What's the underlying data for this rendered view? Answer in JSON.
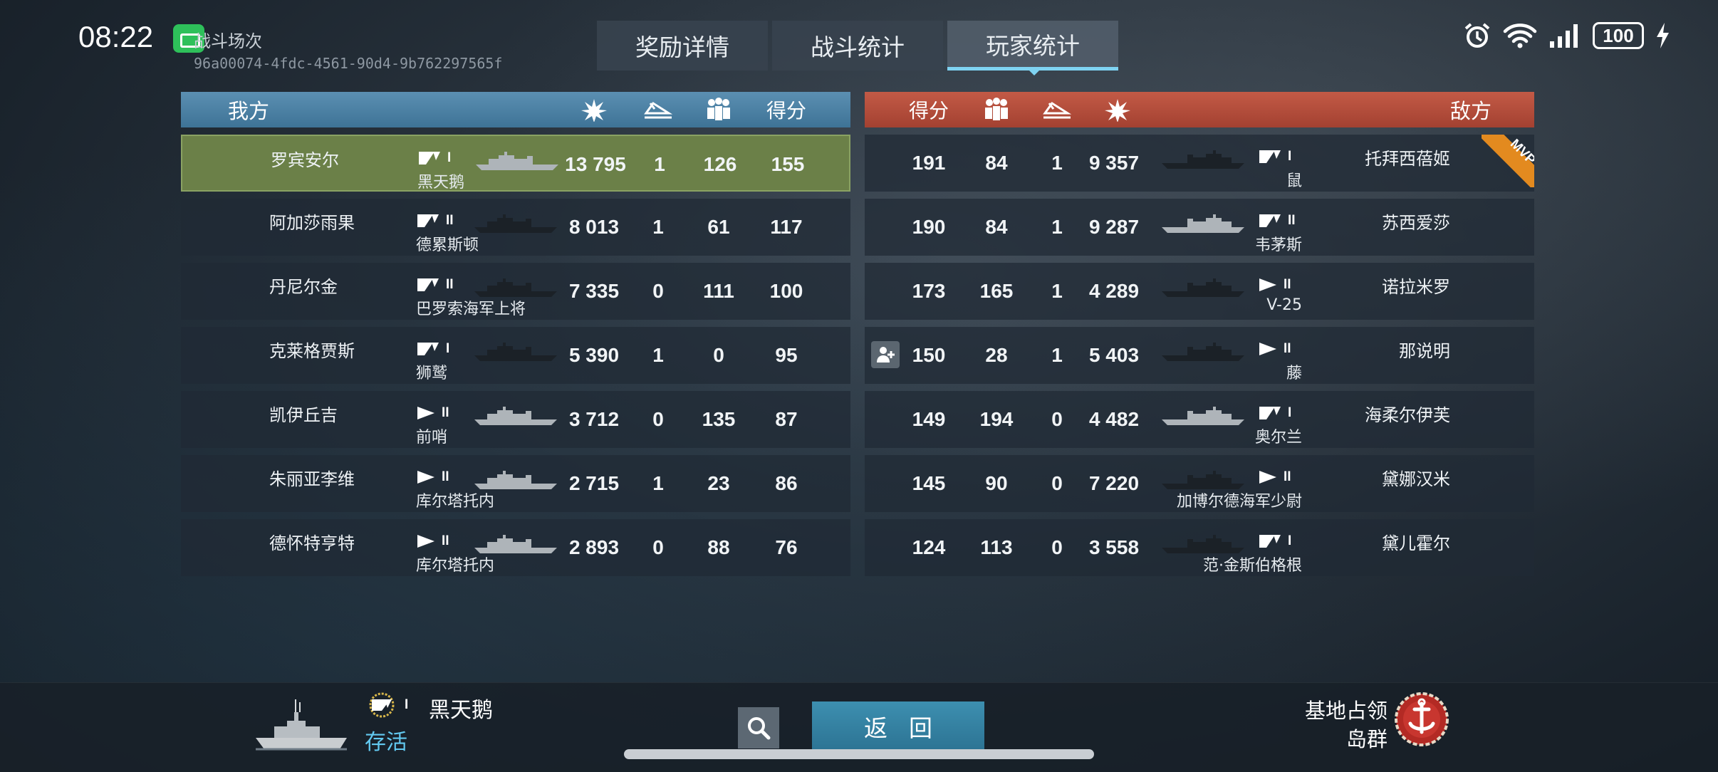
{
  "status_bar": {
    "time": "08:22",
    "battery": "100"
  },
  "battle": {
    "title": "战斗场次",
    "id": "96a00074-4fdc-4561-90d4-9b762297565f"
  },
  "tabs": [
    {
      "label": "奖励详情",
      "active": false
    },
    {
      "label": "战斗统计",
      "active": false
    },
    {
      "label": "玩家统计",
      "active": true
    }
  ],
  "allies": {
    "title": "我方",
    "score_header": "得分",
    "players": [
      {
        "name": "罗宾安尔",
        "ship": "黑天鹅",
        "class": "destroyer",
        "tier": "I",
        "damage": "13 795",
        "kills": "1",
        "assists": "126",
        "score": "155",
        "me": true
      },
      {
        "name": "阿加莎雨果",
        "ship": "德累斯顿",
        "class": "destroyer",
        "tier": "II",
        "damage": "8 013",
        "kills": "1",
        "assists": "61",
        "score": "117"
      },
      {
        "name": "丹尼尔金",
        "ship": "巴罗索海军上将",
        "class": "destroyer",
        "tier": "II",
        "damage": "7 335",
        "kills": "0",
        "assists": "111",
        "score": "100"
      },
      {
        "name": "克莱格贾斯",
        "ship": "狮鹫",
        "class": "destroyer",
        "tier": "I",
        "damage": "5 390",
        "kills": "1",
        "assists": "0",
        "score": "95"
      },
      {
        "name": "凯伊丘吉",
        "ship": "前哨",
        "class": "corvette",
        "tier": "II",
        "damage": "3 712",
        "kills": "0",
        "assists": "135",
        "score": "87"
      },
      {
        "name": "朱丽亚李维",
        "ship": "库尔塔托内",
        "class": "corvette",
        "tier": "II",
        "damage": "2 715",
        "kills": "1",
        "assists": "23",
        "score": "86"
      },
      {
        "name": "德怀特亨特",
        "ship": "库尔塔托内",
        "class": "corvette",
        "tier": "II",
        "damage": "2 893",
        "kills": "0",
        "assists": "88",
        "score": "76"
      }
    ]
  },
  "enemies": {
    "title": "敌方",
    "score_header": "得分",
    "mvp_label": "MVP",
    "players": [
      {
        "name": "托拜西蓓姬",
        "ship": "鼠",
        "class": "destroyer",
        "tier": "I",
        "damage": "9 357",
        "kills": "1",
        "assists": "84",
        "score": "191",
        "mvp": true
      },
      {
        "name": "苏西爱莎",
        "ship": "韦茅斯",
        "class": "destroyer",
        "tier": "II",
        "damage": "9 287",
        "kills": "1",
        "assists": "84",
        "score": "190"
      },
      {
        "name": "诺拉米罗",
        "ship": "V-25",
        "class": "corvette",
        "tier": "II",
        "damage": "4 289",
        "kills": "1",
        "assists": "165",
        "score": "173"
      },
      {
        "name": "那说明",
        "ship": "藤",
        "class": "corvette",
        "tier": "II",
        "damage": "5 403",
        "kills": "1",
        "assists": "28",
        "score": "150",
        "add_friend": true
      },
      {
        "name": "海柔尔伊芙",
        "ship": "奥尔兰",
        "class": "destroyer",
        "tier": "I",
        "damage": "4 482",
        "kills": "0",
        "assists": "194",
        "score": "149"
      },
      {
        "name": "黛娜汉米",
        "ship": "加博尔德海军少尉",
        "class": "corvette",
        "tier": "II",
        "damage": "7 220",
        "kills": "0",
        "assists": "90",
        "score": "145"
      },
      {
        "name": "黛儿霍尔",
        "ship": "范·金斯伯格根",
        "class": "destroyer",
        "tier": "I",
        "damage": "3 558",
        "kills": "0",
        "assists": "113",
        "score": "124"
      }
    ]
  },
  "footer": {
    "tier": "I",
    "ship_name": "黑天鹅",
    "status": "存活",
    "return_label": "返回",
    "mode": "基地占领",
    "map": "岛群"
  },
  "colors": {
    "ally_header": "#4a80a4",
    "enemy_header": "#b34c3a",
    "own_row": "#6b8048",
    "accent": "#7fd3f2",
    "mvp": "#e38a1f"
  }
}
